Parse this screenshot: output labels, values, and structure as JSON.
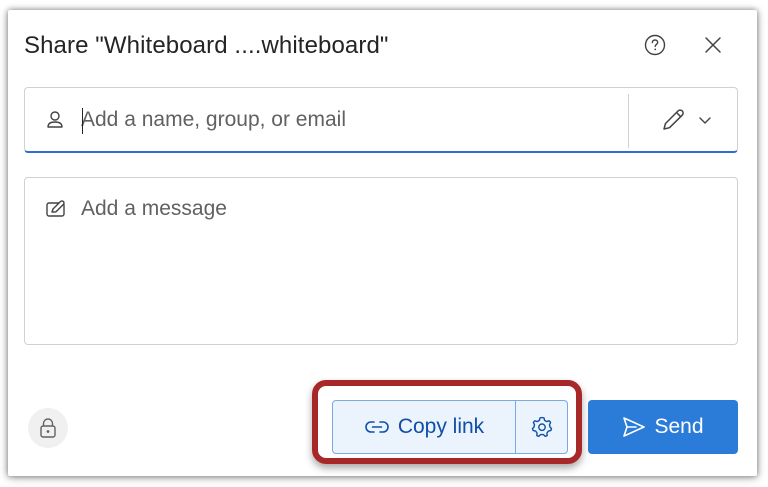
{
  "dialog": {
    "title": "Share \"Whiteboard ....whiteboard\"",
    "help_icon": "question-circle-icon",
    "close_icon": "close-icon"
  },
  "recipient": {
    "placeholder": "Add a name, group, or email",
    "value": "",
    "icon": "person-icon",
    "permission_icon": "pencil-icon",
    "permission_dropdown_icon": "chevron-down-icon"
  },
  "message": {
    "placeholder": "Add a message",
    "value": "",
    "icon": "edit-message-icon"
  },
  "footer": {
    "lock_icon": "lock-icon",
    "copy_link_label": "Copy link",
    "copy_link_icon": "link-icon",
    "link_settings_icon": "gear-icon",
    "send_label": "Send",
    "send_icon": "send-icon"
  },
  "colors": {
    "accent": "#2b7bd8",
    "copy_link_bg": "#ebf3fc",
    "copy_link_text": "#0f4fa8",
    "highlight_border": "#a8282a",
    "focus_underline": "#2b6fd1"
  }
}
